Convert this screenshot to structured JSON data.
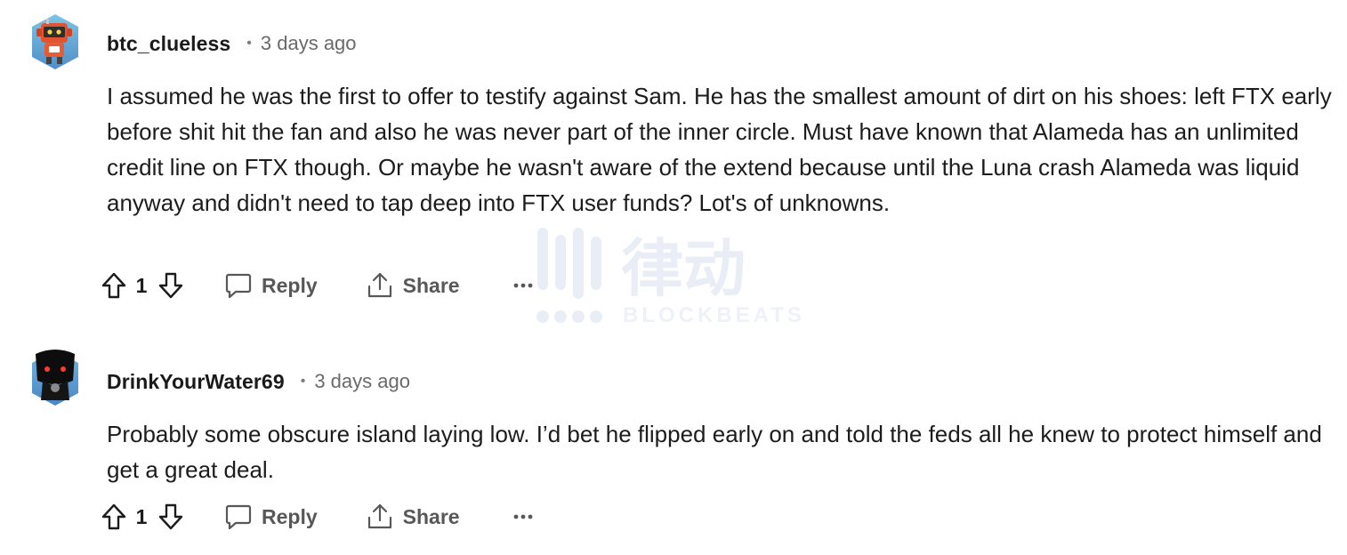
{
  "comments": [
    {
      "username": "btc_clueless",
      "separator": "•",
      "time": "3 days ago",
      "avatar_icon": "robot-avatar-icon",
      "text": "I assumed he was the first to offer to testify against Sam. He has the smallest amount of dirt on his shoes: left FTX early before shit hit the fan and also he was never part of the inner circle. Must have known that Alameda has an unlimited credit line on FTX though. Or maybe he wasn't aware of the extend because until the Luna crash Alameda was liquid anyway and didn't need to tap deep into FTX user funds? Lot's of unknowns.",
      "votes": "1",
      "reply_label": "Reply",
      "share_label": "Share"
    },
    {
      "username": "DrinkYourWater69",
      "separator": "•",
      "time": "3 days ago",
      "avatar_icon": "hooded-figure-avatar-icon",
      "text": "Probably some obscure island laying low. I’d bet he flipped early on and told the feds all he knew to protect himself and get a great deal.",
      "votes": "1",
      "reply_label": "Reply",
      "share_label": "Share"
    }
  ],
  "watermark": {
    "cn_text": "律动",
    "en_text": "BLOCKBEATS"
  },
  "colors": {
    "text": "#1c1c1c",
    "muted": "#6a6a6a",
    "action": "#585858",
    "watermark": "#e9edf6"
  }
}
